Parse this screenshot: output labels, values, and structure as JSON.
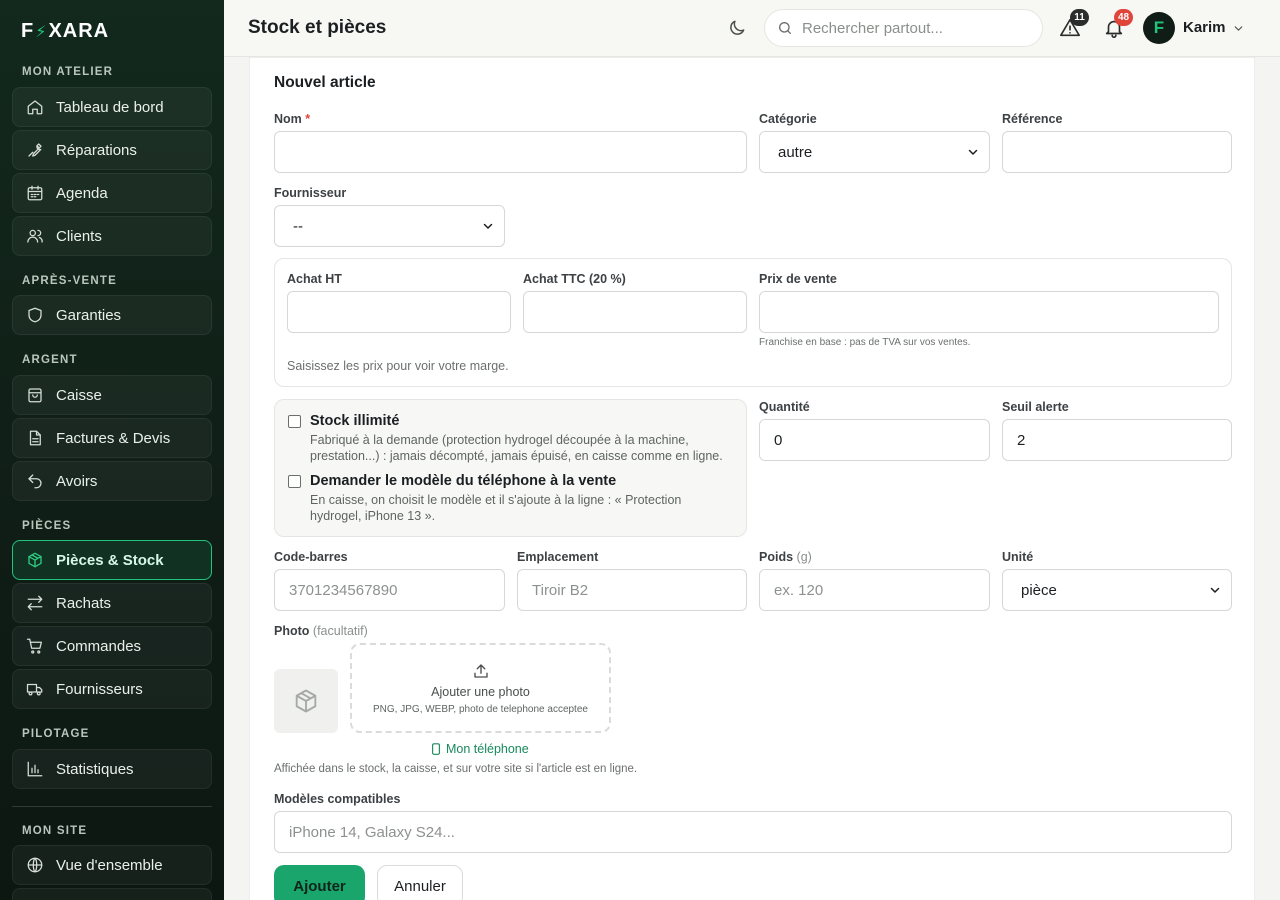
{
  "app": {
    "logo_prefix": "F",
    "logo_suffix": "XARA"
  },
  "sidebar": {
    "sections": [
      {
        "title": "MON ATELIER"
      },
      {
        "title": "APRÈS-VENTE"
      },
      {
        "title": "ARGENT"
      },
      {
        "title": "PIÈCES"
      },
      {
        "title": "PILOTAGE"
      },
      {
        "title": "MON SITE"
      }
    ],
    "items": [
      {
        "label": "Tableau de bord",
        "icon": "home-icon"
      },
      {
        "label": "Réparations",
        "icon": "wrench-icon"
      },
      {
        "label": "Agenda",
        "icon": "calendar-icon"
      },
      {
        "label": "Clients",
        "icon": "users-icon"
      },
      {
        "label": "Garanties",
        "icon": "shield-icon"
      },
      {
        "label": "Caisse",
        "icon": "bag-icon"
      },
      {
        "label": "Factures & Devis",
        "icon": "document-icon"
      },
      {
        "label": "Avoirs",
        "icon": "undo-icon"
      },
      {
        "label": "Pièces & Stock",
        "icon": "box-icon",
        "active": true
      },
      {
        "label": "Rachats",
        "icon": "exchange-icon"
      },
      {
        "label": "Commandes",
        "icon": "cart-icon"
      },
      {
        "label": "Fournisseurs",
        "icon": "truck-icon"
      },
      {
        "label": "Statistiques",
        "icon": "bar-chart-icon"
      },
      {
        "label": "Vue d'ensemble",
        "icon": "globe-icon"
      }
    ]
  },
  "header": {
    "title": "Stock et pièces",
    "search_placeholder": "Rechercher partout...",
    "alerts_count": "11",
    "notifications_count": "48",
    "user_initial": "F",
    "user_name": "Karim",
    "colors": {
      "alert_badge": "#2a2d2b",
      "notif_badge": "#e0453a"
    }
  },
  "form": {
    "title": "Nouvel article",
    "name_label": "Nom",
    "name_required_mark": "*",
    "category_label": "Catégorie",
    "category_value": "autre",
    "reference_label": "Référence",
    "supplier_label": "Fournisseur",
    "supplier_value": "--",
    "purchase_ht_label": "Achat HT",
    "purchase_ttc_label": "Achat TTC (20 %)",
    "sale_price_label": "Prix de vente",
    "vat_note": "Franchise en base : pas de TVA sur vos ventes.",
    "margin_hint": "Saisissez les prix pour voir votre marge.",
    "unlimited_title": "Stock illimité",
    "unlimited_desc_1": "Fabriqué à la demande (protection hydrogel découpée à la machine,",
    "unlimited_desc_2": "prestation...) : jamais décompté, jamais épuisé, en caisse comme en ligne.",
    "ask_model_title": "Demander le modèle du téléphone à la vente",
    "ask_model_desc_1": "En caisse, on choisit le modèle et il s'ajoute à la ligne : « Protection",
    "ask_model_desc_2": "hydrogel, iPhone 13 ».",
    "quantity_label": "Quantité",
    "quantity_value": "0",
    "threshold_label": "Seuil alerte",
    "threshold_value": "2",
    "barcode_label": "Code-barres",
    "barcode_placeholder": "3701234567890",
    "location_label": "Emplacement",
    "location_placeholder": "Tiroir B2",
    "weight_label": "Poids",
    "weight_unit": "(g)",
    "weight_placeholder": "ex. 120",
    "unit_label": "Unité",
    "unit_value": "pièce",
    "photo_label": "Photo",
    "photo_optional": "(facultatif)",
    "photo_add": "Ajouter une photo",
    "photo_formats": "PNG, JPG, WEBP, photo de telephone acceptee",
    "photo_phone_link": "Mon téléphone",
    "photo_hint": "Affichée dans le stock, la caisse, et sur votre site si l'article est en ligne.",
    "models_label": "Modèles compatibles",
    "models_placeholder": "iPhone 14, Galaxy S24...",
    "submit_label": "Ajouter",
    "cancel_label": "Annuler"
  }
}
